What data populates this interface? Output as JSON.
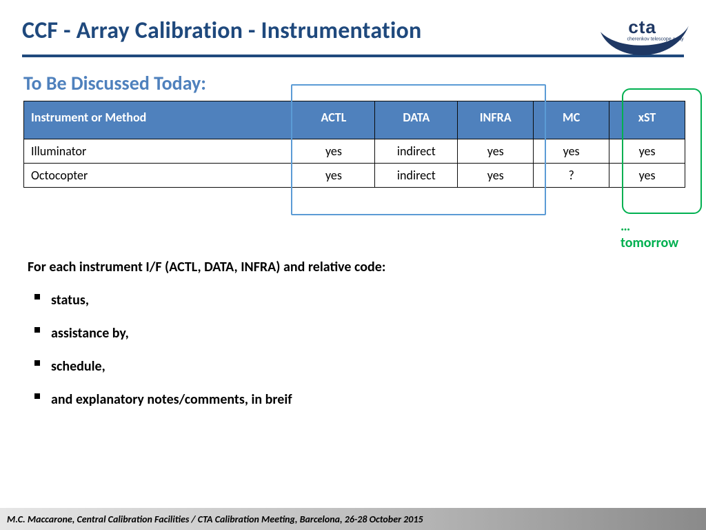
{
  "title": "CCF - Array Calibration - Instrumentation",
  "subhead": "To Be Discussed Today:",
  "table": {
    "headers": [
      "Instrument or Method",
      "ACTL",
      "DATA",
      "INFRA",
      "MC",
      "xST"
    ],
    "rows": [
      [
        "Illuminator",
        "yes",
        "indirect",
        "yes",
        "yes",
        "yes"
      ],
      [
        "Octocopter",
        "yes",
        "indirect",
        "yes",
        "?",
        "yes"
      ]
    ]
  },
  "tomorrow_label": "… tomorrow",
  "body": {
    "lead": "For each instrument I/F (ACTL, DATA, INFRA) and relative code:",
    "bullets": [
      "status,",
      "assistance by,",
      "schedule,",
      "and explanatory notes/comments, in breif"
    ]
  },
  "footer": "M.C. Maccarone, Central Calibration Facilities / CTA Calibration Meeting, Barcelona, 26-28 October 2015",
  "logo": {
    "abbr": "cta",
    "sub": "cherenkov telescope array"
  }
}
